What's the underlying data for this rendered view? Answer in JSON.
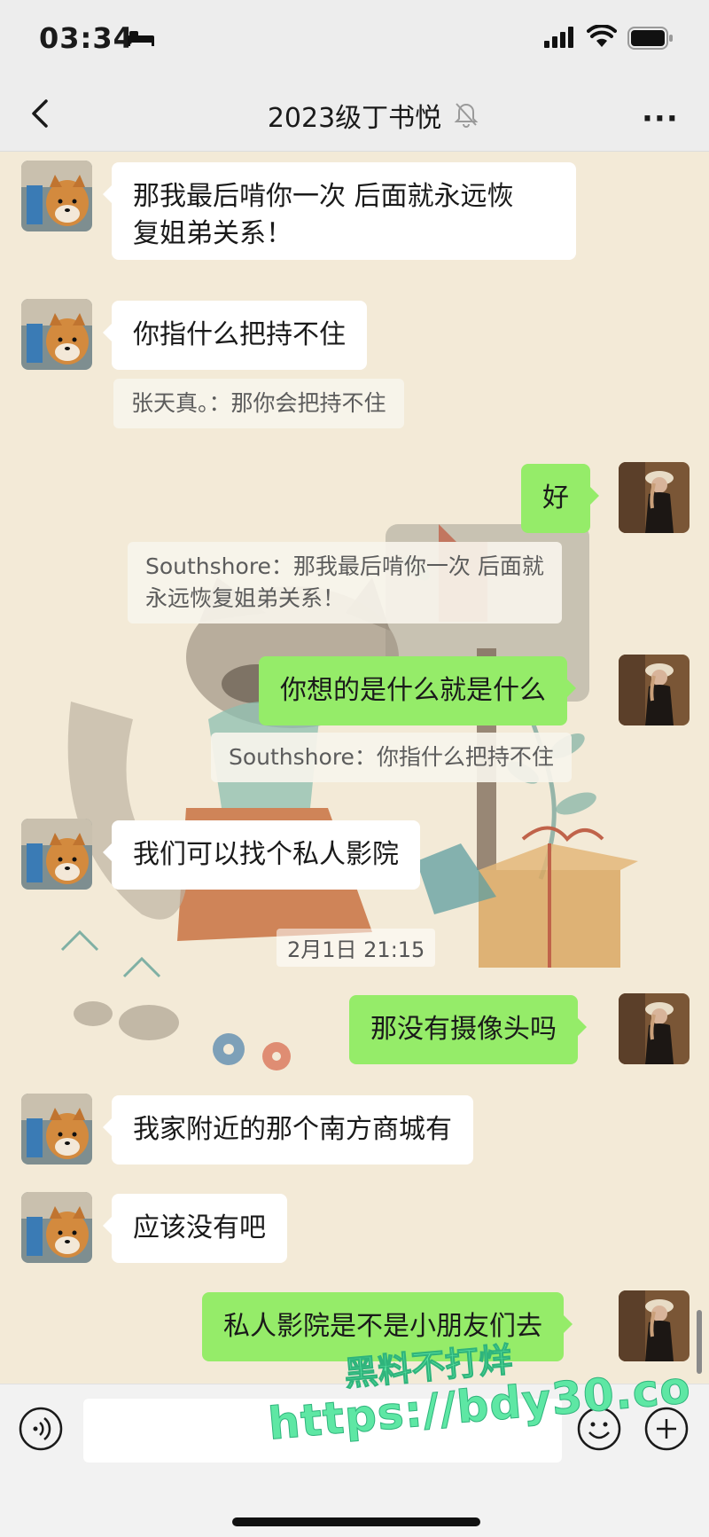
{
  "status_bar": {
    "time": "03:34"
  },
  "header": {
    "title": "2023级丁书悦"
  },
  "messages": [
    {
      "side": "in",
      "lines": [
        "那我最后啃你一次 后面就永远恢",
        "复姐弟关系！"
      ]
    },
    {
      "side": "in",
      "lines": [
        "你指什么把持不住"
      ],
      "quote": "张天真。：那你会把持不住"
    },
    {
      "side": "out",
      "lines": [
        "好"
      ],
      "quote_lines": [
        "Southshore：那我最后啃你一次 后面就",
        "永远恢复姐弟关系！"
      ]
    },
    {
      "side": "out",
      "lines": [
        "你想的是什么就是什么"
      ],
      "quote": "Southshore：你指什么把持不住"
    },
    {
      "side": "in",
      "lines": [
        "我们可以找个私人影院"
      ]
    },
    {
      "side": "out",
      "lines": [
        "那没有摄像头吗"
      ]
    },
    {
      "side": "in",
      "lines": [
        "我家附近的那个南方商城有"
      ]
    },
    {
      "side": "in",
      "lines": [
        "应该没有吧"
      ]
    },
    {
      "side": "out",
      "lines": [
        "私人影院是不是小朋友们去"
      ]
    }
  ],
  "timestamp": "2月1日 21:15",
  "watermark": {
    "line1": "黑料不打烊",
    "line2": "https://bdy30.co"
  },
  "colors": {
    "bubble_out": "#95ec69",
    "bubble_in": "#ffffff",
    "chat_bg": "#f3ead7",
    "bar_bg": "#ededed"
  },
  "icons": [
    "back-icon",
    "mute-icon",
    "more-icon",
    "voice-icon",
    "emoji-icon",
    "plus-icon"
  ]
}
